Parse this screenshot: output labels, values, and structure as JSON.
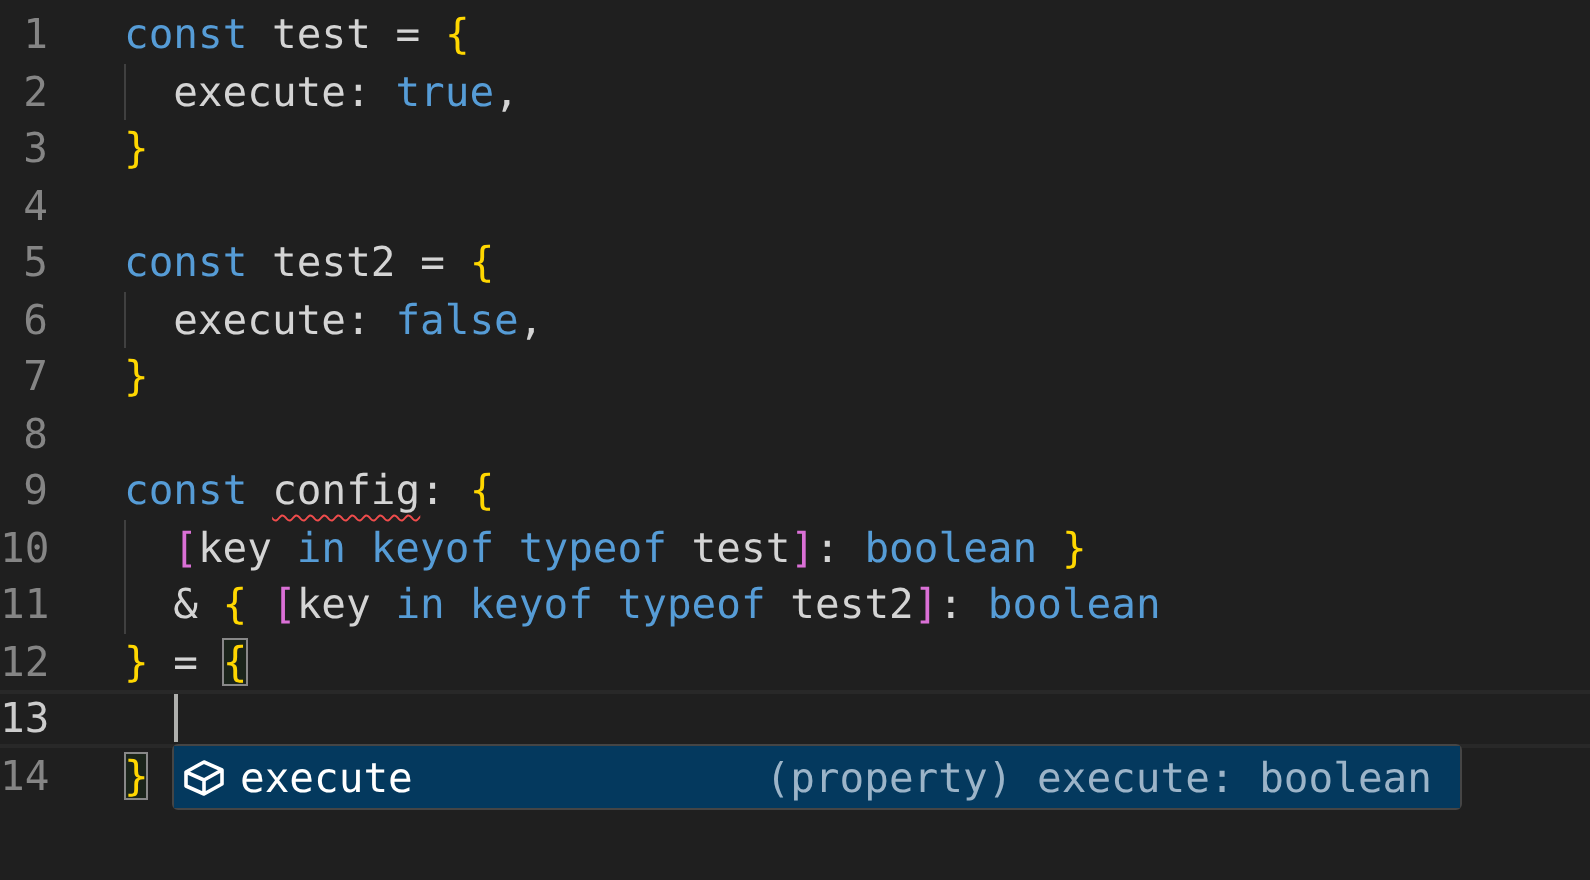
{
  "editor": {
    "lines": [
      {
        "number": "1",
        "tokens": [
          {
            "kind": "keyword",
            "text": "const"
          },
          {
            "kind": "plain",
            "text": " test = "
          },
          {
            "kind": "bracket",
            "text": "{"
          }
        ]
      },
      {
        "number": "2",
        "indent": true,
        "tokens": [
          {
            "kind": "plain",
            "text": "execute: "
          },
          {
            "kind": "keyword",
            "text": "true"
          },
          {
            "kind": "plain",
            "text": ","
          }
        ]
      },
      {
        "number": "3",
        "tokens": [
          {
            "kind": "bracket",
            "text": "}"
          }
        ]
      },
      {
        "number": "4"
      },
      {
        "number": "5",
        "tokens": [
          {
            "kind": "keyword",
            "text": "const"
          },
          {
            "kind": "plain",
            "text": " test2 = "
          },
          {
            "kind": "bracket",
            "text": "{"
          }
        ]
      },
      {
        "number": "6",
        "indent": true,
        "tokens": [
          {
            "kind": "plain",
            "text": "execute: "
          },
          {
            "kind": "keyword",
            "text": "false"
          },
          {
            "kind": "plain",
            "text": ","
          }
        ]
      },
      {
        "number": "7",
        "tokens": [
          {
            "kind": "bracket",
            "text": "}"
          }
        ]
      },
      {
        "number": "8"
      },
      {
        "number": "9",
        "tokens": [
          {
            "kind": "keyword",
            "text": "const "
          },
          {
            "kind": "plain",
            "text": "config",
            "error": true
          },
          {
            "kind": "plain",
            "text": ": "
          },
          {
            "kind": "bracket",
            "text": "{"
          }
        ]
      },
      {
        "number": "10",
        "indent": true,
        "tokens": [
          {
            "kind": "bracket2",
            "text": "["
          },
          {
            "kind": "plain",
            "text": "key "
          },
          {
            "kind": "keyword",
            "text": "in keyof typeof"
          },
          {
            "kind": "plain",
            "text": " test"
          },
          {
            "kind": "bracket2",
            "text": "]"
          },
          {
            "kind": "plain",
            "text": ": "
          },
          {
            "kind": "keyword",
            "text": "boolean"
          },
          {
            "kind": "bracket",
            "text": " }"
          }
        ]
      },
      {
        "number": "11",
        "indent": true,
        "tokens": [
          {
            "kind": "plain",
            "text": "& "
          },
          {
            "kind": "bracket",
            "text": "{ "
          },
          {
            "kind": "bracket2",
            "text": "["
          },
          {
            "kind": "plain",
            "text": "key "
          },
          {
            "kind": "keyword",
            "text": "in keyof typeof"
          },
          {
            "kind": "plain",
            "text": " test2"
          },
          {
            "kind": "bracket2",
            "text": "]"
          },
          {
            "kind": "plain",
            "text": ": "
          },
          {
            "kind": "keyword",
            "text": "boolean"
          }
        ]
      },
      {
        "number": "12",
        "tokens": [
          {
            "kind": "bracket",
            "text": "}"
          },
          {
            "kind": "plain",
            "text": " = "
          },
          {
            "kind": "bracket",
            "text": "{",
            "matched": true
          }
        ]
      },
      {
        "number": "13",
        "indent": true,
        "current": true
      },
      {
        "number": "14",
        "tokens": [
          {
            "kind": "bracket",
            "text": "}",
            "matched": true
          }
        ]
      }
    ]
  },
  "suggest": {
    "items": [
      {
        "label": "execute",
        "detail": "(property) execute: boolean",
        "selected": true
      }
    ]
  }
}
